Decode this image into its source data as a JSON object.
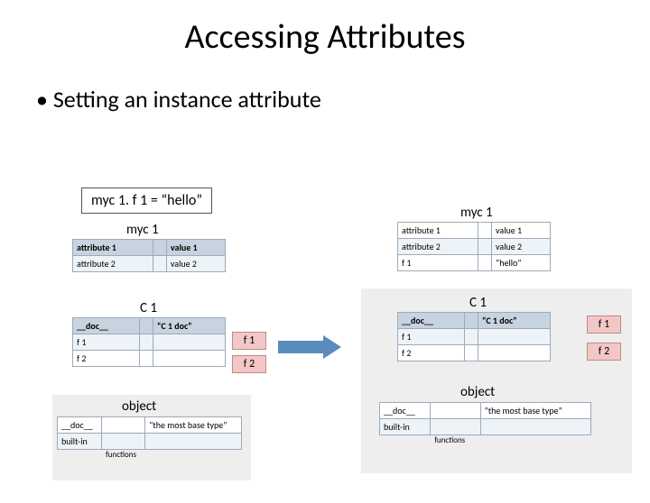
{
  "title": "Accessing Attributes",
  "bullet": "Setting an instance attribute",
  "code": "myc 1. f 1 = “hello”",
  "left": {
    "myc1_hdr": "myc 1",
    "myc1_rows": [
      [
        "attribute 1",
        "",
        "value 1"
      ],
      [
        "attribute 2",
        "",
        "value 2"
      ]
    ],
    "C1_hdr": "C 1",
    "C1_rows": [
      [
        "__doc__",
        "",
        "“C 1 doc”"
      ],
      [
        "f 1",
        "",
        ""
      ],
      [
        "f 2",
        "",
        ""
      ]
    ],
    "fbox1": "f 1",
    "fbox2": "f 2",
    "obj_hdr": "object",
    "obj_rows": [
      [
        "__doc__",
        "",
        "“the most base type”"
      ],
      [
        "built-in",
        "functions",
        ""
      ]
    ]
  },
  "right": {
    "myc1_hdr": "myc 1",
    "myc1_rows": [
      [
        "attribute 1",
        "",
        "value 1"
      ],
      [
        "attribute 2",
        "",
        "value 2"
      ],
      [
        "f 1",
        "",
        "“hello”"
      ]
    ],
    "C1_hdr": "C 1",
    "C1_rows": [
      [
        "__doc__",
        "",
        "“C 1 doc”"
      ],
      [
        "f 1",
        "",
        ""
      ],
      [
        "f 2",
        "",
        ""
      ]
    ],
    "fbox1": "f 1",
    "fbox2": "f 2",
    "obj_hdr": "object",
    "obj_rows": [
      [
        "__doc__",
        "",
        "“the most base type”"
      ],
      [
        "built-in",
        "functions",
        ""
      ]
    ]
  }
}
